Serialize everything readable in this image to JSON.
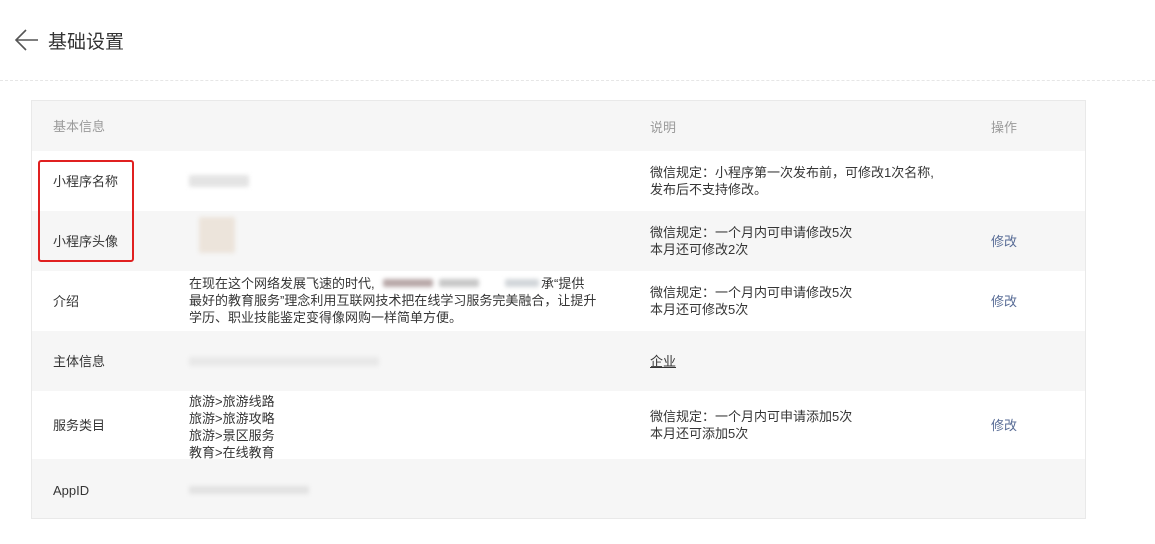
{
  "header": {
    "title": "基础设置"
  },
  "table": {
    "headers": {
      "info": "基本信息",
      "desc": "说明",
      "op": "操作"
    },
    "rows": {
      "name": {
        "label": "小程序名称",
        "desc1": "微信规定：小程序第一次发布前，可修改1次名称,",
        "desc2": "发布后不支持修改。"
      },
      "avatar": {
        "label": "小程序头像",
        "desc1": "微信规定：一个月内可申请修改5次",
        "desc2": "本月还可修改2次",
        "op": "修改"
      },
      "intro": {
        "label": "介绍",
        "line1a": "在现在这个网络发展飞速的时代,",
        "line1b": "承“提供",
        "line2": "最好的教育服务”理念利用互联网技术把在线学习服务完美融合，让提升",
        "line3": "学历、职业技能鉴定变得像网购一样简单方便。",
        "desc1": "微信规定：一个月内可申请修改5次",
        "desc2": "本月还可修改5次",
        "op": "修改"
      },
      "subject": {
        "label": "主体信息",
        "desc": "企业"
      },
      "category": {
        "label": "服务类目",
        "items": [
          "旅游>旅游线路",
          "旅游>旅游攻略",
          "旅游>景区服务",
          "教育>在线教育"
        ],
        "desc1": "微信规定：一个月内可申请添加5次",
        "desc2": "本月还可添加5次",
        "op": "修改"
      },
      "appid": {
        "label": "AppID"
      }
    }
  },
  "colors": {
    "link": "#576b95",
    "highlight": "#e02020",
    "row_gray": "#f6f6f6"
  },
  "icons": {
    "back": "arrow-left-icon"
  }
}
